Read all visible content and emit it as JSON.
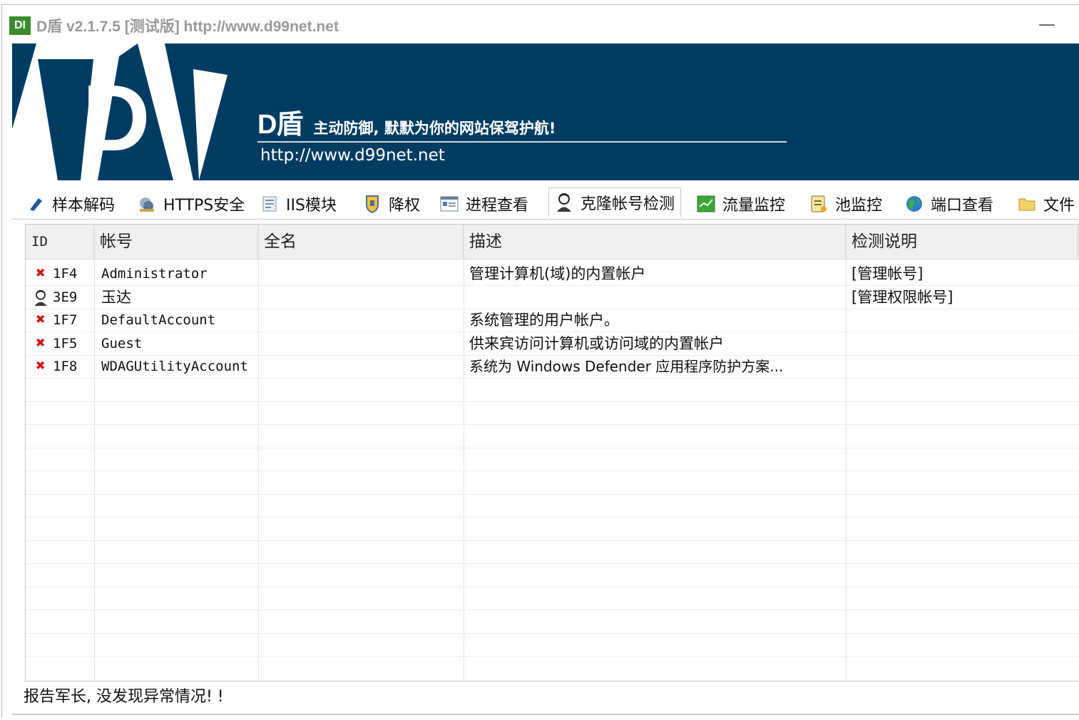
{
  "window": {
    "title": "D盾 v2.1.7.5 [测试版] http://www.d99net.net",
    "icon_label": "DI",
    "minimize_glyph": "—"
  },
  "banner": {
    "logo_letter": "D",
    "brand_name": "D盾",
    "slogan": "主动防御, 默默为你的网站保驾护航!",
    "url": "http://www.d99net.net",
    "background": "#003c62"
  },
  "tabs": [
    {
      "label": "样本解码",
      "icon": "wand-icon",
      "active": false
    },
    {
      "label": "HTTPS安全",
      "icon": "satellite-icon",
      "active": false
    },
    {
      "label": "IIS模块",
      "icon": "module-icon",
      "active": false
    },
    {
      "label": "降权",
      "icon": "shield-icon",
      "active": false
    },
    {
      "label": "进程查看",
      "icon": "window-icon",
      "active": false
    },
    {
      "label": "克隆帐号检测",
      "icon": "user-icon",
      "active": true
    },
    {
      "label": "流量监控",
      "icon": "chart-icon",
      "active": false
    },
    {
      "label": "池监控",
      "icon": "note-icon",
      "active": false
    },
    {
      "label": "端口查看",
      "icon": "globe-icon",
      "active": false
    },
    {
      "label": "文件",
      "icon": "folder-icon",
      "active": false
    }
  ],
  "table": {
    "columns": [
      "ID",
      "帐号",
      "全名",
      "描述",
      "检测说明"
    ],
    "rows": [
      {
        "status": "error",
        "id": "1F4",
        "account": "Administrator",
        "fullname": "",
        "description": "管理计算机(域)的内置帐户",
        "note": "[管理帐号]"
      },
      {
        "status": "user",
        "id": "3E9",
        "account": "玉达",
        "fullname": "",
        "description": "",
        "note": "[管理权限帐号]"
      },
      {
        "status": "error",
        "id": "1F7",
        "account": "DefaultAccount",
        "fullname": "",
        "description": "系统管理的用户帐户。",
        "note": ""
      },
      {
        "status": "error",
        "id": "1F5",
        "account": "Guest",
        "fullname": "",
        "description": "供来宾访问计算机或访问域的内置帐户",
        "note": ""
      },
      {
        "status": "error",
        "id": "1F8",
        "account": "WDAGUtilityAccount",
        "fullname": "",
        "description": "系统为 Windows Defender 应用程序防护方案...",
        "note": ""
      }
    ]
  },
  "status_bar": {
    "message": "报告军长, 没发现异常情况! !"
  },
  "colors": {
    "error_mark": "#d0161c",
    "header_bg": "#f0f0f0"
  }
}
